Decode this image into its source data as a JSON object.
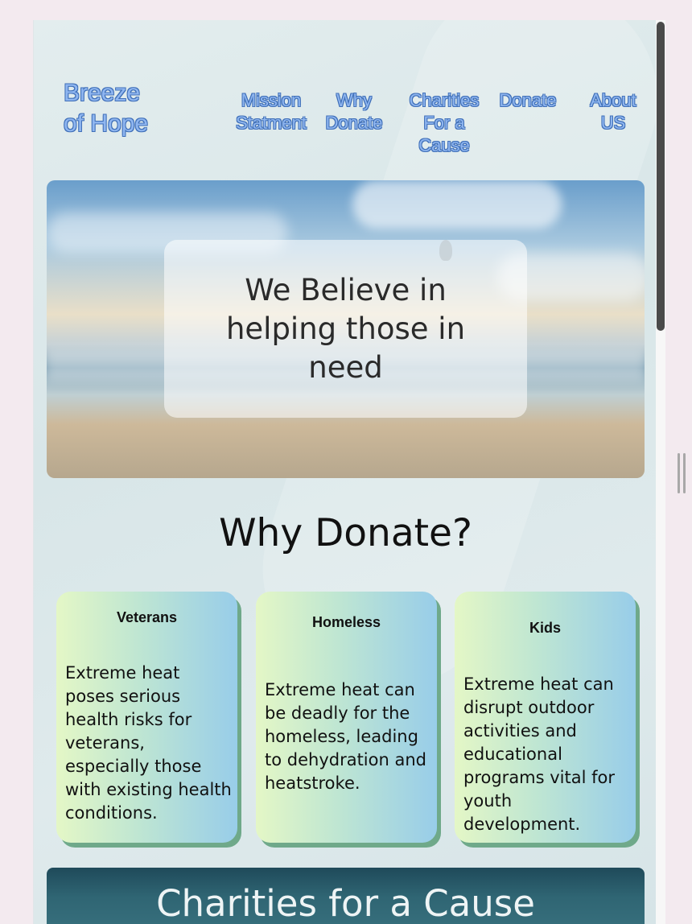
{
  "site": {
    "logo": "Breeze of Hope",
    "nav": [
      {
        "label": "Mission Statment"
      },
      {
        "label": "Why Donate"
      },
      {
        "label": "Charities For a Cause"
      },
      {
        "label": "Donate"
      },
      {
        "label": "About US"
      }
    ]
  },
  "hero": {
    "headline": "We Believe in helping those in need"
  },
  "why_donate": {
    "title": "Why Donate?",
    "cards": [
      {
        "title": "Veterans",
        "body": "Extreme heat poses serious health risks for veterans, especially those with existing health conditions."
      },
      {
        "title": "Homeless",
        "body": "Extreme heat can be deadly for the homeless, leading to dehydration and heatstroke."
      },
      {
        "title": "Kids",
        "body": "Extreme heat can disrupt outdoor activities and educational programs vital for youth development."
      }
    ]
  },
  "charities": {
    "title": "Charities for a Cause"
  },
  "colors": {
    "nav_text": "#8fb6f0",
    "nav_outline": "#3f6fb8",
    "card_gradient_start": "#e4f7c6",
    "card_gradient_end": "#98cde9",
    "card_shadow": "#6fa98a",
    "charities_bg": "#2f6573"
  },
  "icons": {
    "scrollbar": "vertical-scrollbar",
    "resize": "resize-grip-icon"
  }
}
